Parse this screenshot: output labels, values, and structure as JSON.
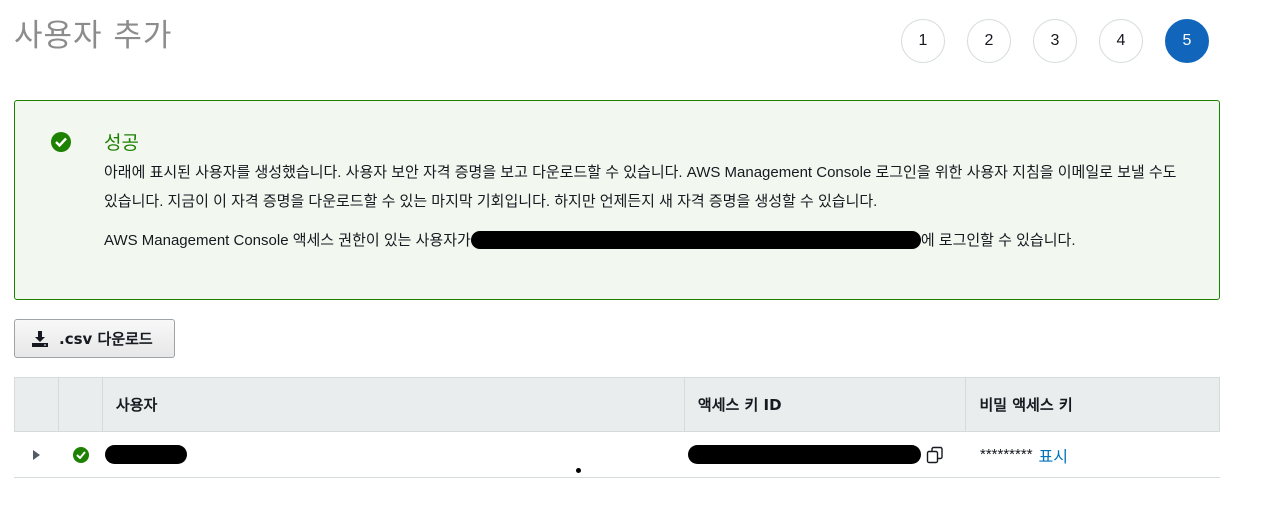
{
  "page": {
    "title": "사용자 추가"
  },
  "steps": {
    "items": [
      "1",
      "2",
      "3",
      "4",
      "5"
    ],
    "active": "5"
  },
  "alert": {
    "title": "성공",
    "body": "아래에 표시된 사용자를 생성했습니다. 사용자 보안 자격 증명을 보고 다운로드할 수 있습니다. AWS Management Console 로그인을 위한 사용자 지침을 이메일로 보낼 수도 있습니다. 지금이 이 자격 증명을 다운로드할 수 있는 마지막 기회입니다. 하지만 언제든지 새 자격 증명을 생성할 수 있습니다.",
    "console_prefix": "AWS Management Console 액세스 권한이 있는 사용자가",
    "console_suffix": "에 로그인할 수 있습니다.",
    "accent_color": "#1d8102"
  },
  "toolbar": {
    "csv_label": ".csv 다운로드",
    "download_icon": "download-icon"
  },
  "table": {
    "headers": [
      "사용자",
      "액세스 키 ID",
      "비밀 액세스 키"
    ],
    "rows": [
      {
        "secret_masked": "*********",
        "show_label": "표시"
      }
    ]
  },
  "colors": {
    "primary": "#1166bb",
    "link": "#0073bb",
    "success": "#1d8102"
  }
}
